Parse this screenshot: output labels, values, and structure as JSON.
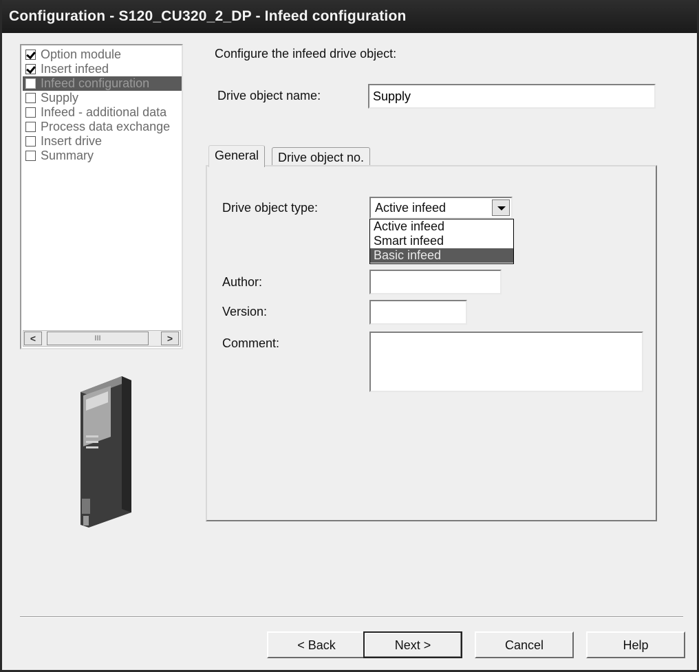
{
  "window": {
    "title": "Configuration - S120_CU320_2_DP - Infeed configuration"
  },
  "steps": [
    {
      "label": "Option module",
      "checked": true
    },
    {
      "label": "Insert infeed",
      "checked": true
    },
    {
      "label": "Infeed configuration",
      "checked": false,
      "active": true
    },
    {
      "label": "Supply",
      "checked": false
    },
    {
      "label": "Infeed - additional data",
      "checked": false
    },
    {
      "label": "Process data exchange",
      "checked": false
    },
    {
      "label": "Insert drive",
      "checked": false
    },
    {
      "label": "Summary",
      "checked": false
    }
  ],
  "scrollbar": {
    "left": "<",
    "right": ">",
    "thumb": "III"
  },
  "main": {
    "prompt": "Configure the infeed drive object:",
    "drive_object_name_label": "Drive object name:",
    "drive_object_name_value": "Supply"
  },
  "tabs": [
    {
      "label": "General"
    },
    {
      "label": "Drive object no."
    }
  ],
  "general": {
    "type_label": "Drive object type:",
    "type_value": "Active infeed",
    "type_options": [
      "Active infeed",
      "Smart infeed",
      "Basic infeed"
    ],
    "highlighted_option": "Basic infeed",
    "author_label": "Author:",
    "author_value": "",
    "version_label": "Version:",
    "version_value": "",
    "comment_label": "Comment:",
    "comment_value": ""
  },
  "buttons": {
    "back": "< Back",
    "next": "Next >",
    "cancel": "Cancel",
    "help": "Help"
  }
}
